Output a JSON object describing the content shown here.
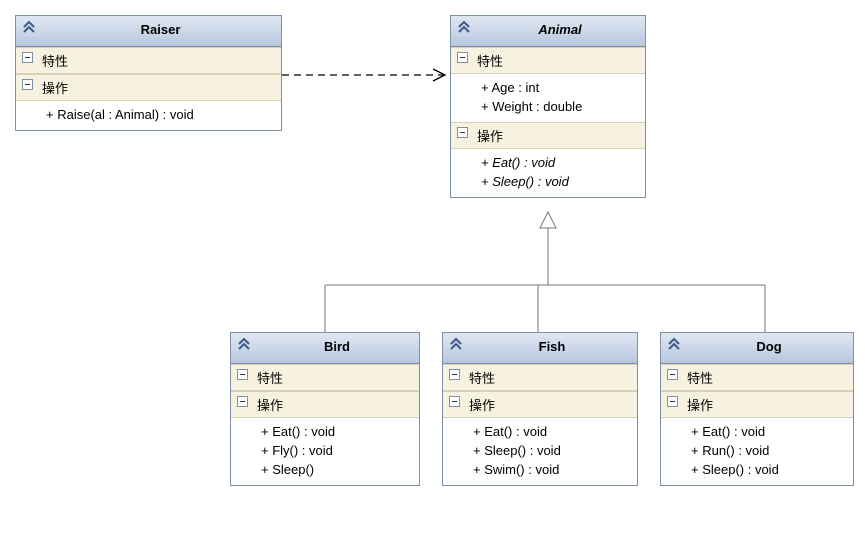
{
  "labels": {
    "attributes": "特性",
    "operations": "操作"
  },
  "classes": {
    "raiser": {
      "name": "Raiser",
      "abstract": false,
      "attributes": [],
      "operations": [
        {
          "text": "+ Raise(al : Animal) : void",
          "italic": false
        }
      ]
    },
    "animal": {
      "name": "Animal",
      "abstract": true,
      "attributes": [
        {
          "text": "+ Age : int"
        },
        {
          "text": "+ Weight : double"
        }
      ],
      "operations": [
        {
          "text": "+ Eat() : void",
          "italic": true
        },
        {
          "text": "+ Sleep() : void",
          "italic": true
        }
      ]
    },
    "bird": {
      "name": "Bird",
      "abstract": false,
      "attributes": [],
      "operations": [
        {
          "text": "+ Eat() : void"
        },
        {
          "text": "+ Fly() : void"
        },
        {
          "text": "+ Sleep()"
        }
      ]
    },
    "fish": {
      "name": "Fish",
      "abstract": false,
      "attributes": [],
      "operations": [
        {
          "text": "+ Eat() : void"
        },
        {
          "text": "+ Sleep() : void"
        },
        {
          "text": "+ Swim() : void"
        }
      ]
    },
    "dog": {
      "name": "Dog",
      "abstract": false,
      "attributes": [],
      "operations": [
        {
          "text": "+ Eat() : void"
        },
        {
          "text": "+ Run() : void"
        },
        {
          "text": "+ Sleep() : void"
        }
      ]
    }
  },
  "relations": {
    "raiser_to_animal": {
      "type": "dependency",
      "from": "raiser",
      "to": "animal"
    },
    "bird_to_animal": {
      "type": "generalization",
      "from": "bird",
      "to": "animal"
    },
    "fish_to_animal": {
      "type": "generalization",
      "from": "fish",
      "to": "animal"
    },
    "dog_to_animal": {
      "type": "generalization",
      "from": "dog",
      "to": "animal"
    }
  },
  "chart_data": {
    "type": "uml-class-diagram",
    "classes": [
      {
        "name": "Raiser",
        "abstract": false,
        "attributes": [],
        "operations": [
          "+ Raise(al : Animal) : void"
        ]
      },
      {
        "name": "Animal",
        "abstract": true,
        "attributes": [
          "+ Age : int",
          "+ Weight : double"
        ],
        "operations": [
          "+ Eat() : void",
          "+ Sleep() : void"
        ]
      },
      {
        "name": "Bird",
        "abstract": false,
        "attributes": [],
        "operations": [
          "+ Eat() : void",
          "+ Fly() : void",
          "+ Sleep()"
        ]
      },
      {
        "name": "Fish",
        "abstract": false,
        "attributes": [],
        "operations": [
          "+ Eat() : void",
          "+ Sleep() : void",
          "+ Swim() : void"
        ]
      },
      {
        "name": "Dog",
        "abstract": false,
        "attributes": [],
        "operations": [
          "+ Eat() : void",
          "+ Run() : void",
          "+ Sleep() : void"
        ]
      }
    ],
    "relations": [
      {
        "type": "dependency",
        "from": "Raiser",
        "to": "Animal"
      },
      {
        "type": "generalization",
        "from": "Bird",
        "to": "Animal"
      },
      {
        "type": "generalization",
        "from": "Fish",
        "to": "Animal"
      },
      {
        "type": "generalization",
        "from": "Dog",
        "to": "Animal"
      }
    ]
  }
}
